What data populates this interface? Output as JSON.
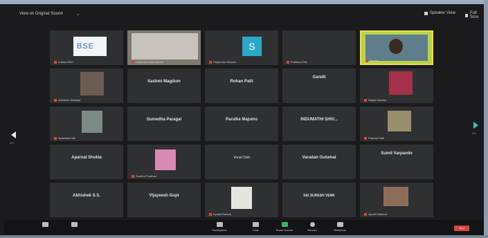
{
  "topbar": {
    "view_label": "View on Original Sound",
    "view_caret": "⌄",
    "speaker_view": "Speaker View",
    "exit": "Full Scre"
  },
  "pagination": {
    "left": "2/3",
    "right": "2/3"
  },
  "tiles": [
    {
      "name": "",
      "foot": "Lokhar B&O"
    },
    {
      "name": "",
      "foot": "Lakshmi Kumar Ashok"
    },
    {
      "name": "",
      "foot": "Satyendar Srivasti"
    },
    {
      "name": "",
      "foot": "Pratiksa Patil"
    },
    {
      "name": "",
      "foot": "Vikrant"
    },
    {
      "name": "",
      "foot": "Abhishek Katariya"
    },
    {
      "name": "Sashmi Magdum",
      "foot": ""
    },
    {
      "name": "Rohan Patil",
      "foot": ""
    },
    {
      "name": "Gandlt",
      "foot": ""
    },
    {
      "name": "",
      "foot": "Nayjot Kamkar"
    },
    {
      "name": "",
      "foot": "Ayushank Vali"
    },
    {
      "name": "Sumedha Paragal",
      "foot": ""
    },
    {
      "name": "Parulke Majumo",
      "foot": ""
    },
    {
      "name": "INDUMATHI SHIV...",
      "foot": ""
    },
    {
      "name": "",
      "foot": "Prabhat Patil"
    },
    {
      "name": "Aparnal Shukla",
      "foot": ""
    },
    {
      "name": "",
      "foot": "Sumitra Pradhan"
    },
    {
      "name": "Venal Dixit",
      "foot": ""
    },
    {
      "name": "Varadan Gulumal",
      "foot": ""
    },
    {
      "name": "Sumit Varpande",
      "foot": ""
    },
    {
      "name": "Abhishek S.S.",
      "foot": ""
    },
    {
      "name": "Vijayeesh Gupt",
      "foot": ""
    },
    {
      "name": "",
      "foot": "Ayushi Raman"
    },
    {
      "name": "SAI SURESH VENK",
      "foot": ""
    },
    {
      "name": "",
      "foot": "Ayushi Rathore"
    }
  ],
  "tile_misc": {
    "bse_logo": "BSE",
    "s_avatar": "S"
  },
  "toolbar": {
    "participants": "Participants",
    "chat": "Chat",
    "share": "Share Screen",
    "record": "Record",
    "reactions": "Reactions",
    "end": "End"
  },
  "colors": {
    "accent": "#2ec7c9",
    "danger": "#d9463f",
    "tile": "#2f3032",
    "background": "#1b1b1d"
  }
}
